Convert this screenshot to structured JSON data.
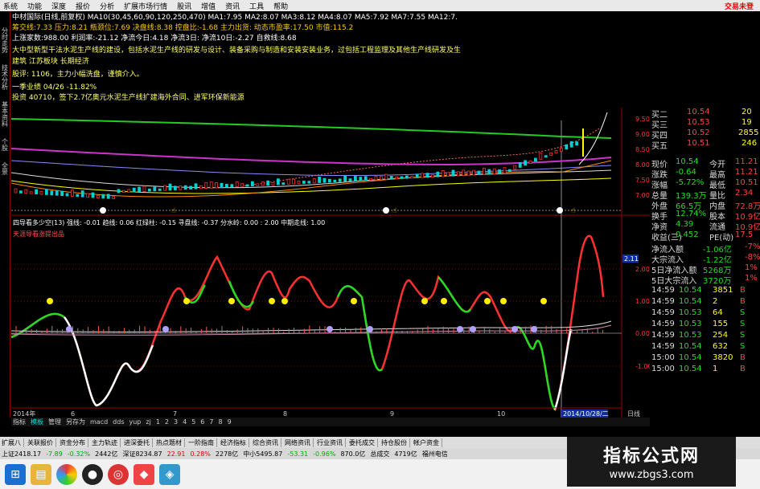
{
  "menu": [
    "系统",
    "功能",
    "深度",
    "报价",
    "分析",
    "扩展市场行情",
    "股讯",
    "增值",
    "资讯",
    "工具",
    "帮助"
  ],
  "brand": "交易未登",
  "lefttabs": [
    "分时走势",
    "技术分析",
    "基本资料",
    "个股",
    "全景"
  ],
  "info": {
    "l1": "中材国际(日线,前复权) MA10(30,45,60,90,120,250,470) MA1:7.95 MA2:8.07 MA3:8.12 MA4:8.07 MA5:7.92 MA7:7.55 MA12:7.",
    "l2": "筹交线:7.33 压力:8.21 瓶颈位:7.69 决盘线:8.38 控盘比:-1.68 主力出货: 动态市盈率:17.50 市值:115.2",
    "l3": "上涨家数:988.00 利润率:-21.12 净流今日:4.18 净流3日: 净流10日:-2.27 自救线:8.68",
    "l4": "大中型新型干法水泥生产线的建设，包括水泥生产线的研发与设计、装备采购与制造和安装安装业务，过包括工程监理及其他生产线研发及生",
    "l5": "建筑 江苏板块 长期经济",
    "l6": "股评: 1106，主力小幅洗盘，谨慎介入。",
    "l7": "一季业绩 04/26 -11.82%",
    "l8": "投资 40710，签下2.7亿奥元水泥生产线扩建海外合同、进军环保新能源"
  },
  "pricelabels": [
    "9.50",
    "9.00",
    "8.50",
    "8.00",
    "7.50",
    "7.00"
  ],
  "sub": {
    "title": "四导看多少空(13) 强线: -0.01 趋线: 0.06 红绿柱: -0.15 寻盘线: -0.37 分水岭: 0.00 : 2.00 中期走线: 1.00",
    "sub2": "天涯导看涨提出品",
    "ylabels": [
      "2.00",
      "1.00",
      "0.00",
      "-1.00"
    ],
    "marker": "2.11"
  },
  "datebar": {
    "year": "2014年",
    "months": [
      "6",
      "7",
      "8",
      "9",
      "10"
    ],
    "date": "2014/10/28/二",
    "right": "日线"
  },
  "right": {
    "bids": [
      {
        "label": "买二",
        "price": "10.54",
        "vol": "20"
      },
      {
        "label": "买三",
        "price": "10.53",
        "vol": "19"
      },
      {
        "label": "买四",
        "price": "10.52",
        "vol": "2855"
      },
      {
        "label": "买五",
        "price": "10.51",
        "vol": "246"
      }
    ],
    "stats": [
      {
        "a": "现价",
        "b": "10.54",
        "c": "今开",
        "d": "11.21"
      },
      {
        "a": "涨跌",
        "b": "-0.64",
        "c": "最高",
        "d": "11.21"
      },
      {
        "a": "涨幅",
        "b": "-5.72%",
        "c": "最低",
        "d": "10.51"
      },
      {
        "a": "总量",
        "b": "139.3万",
        "c": "量比",
        "d": "2.34"
      },
      {
        "a": "外盘",
        "b": "66.5万",
        "c": "内盘",
        "d": "72.8万"
      },
      {
        "a": "换手",
        "b": "12.74%",
        "c": "股本",
        "d": "10.9亿"
      },
      {
        "a": "净资",
        "b": "4.39",
        "c": "流通",
        "d": "10.9亿"
      },
      {
        "a": "收益(三)",
        "b": "0.452",
        "c": "PE(动)",
        "d": "17.5"
      }
    ],
    "flows": [
      {
        "a": "净流入额",
        "b": "-1.06亿",
        "c": "-7%"
      },
      {
        "a": "大宗流入",
        "b": "-1.22亿",
        "c": "-8%"
      },
      {
        "a": "5日净流入额",
        "b": "5268万",
        "c": "1%"
      },
      {
        "a": "5日大宗流入",
        "b": "3720万",
        "c": "1%"
      }
    ],
    "ticks": [
      {
        "t": "14:59",
        "p": "10.54",
        "v": "3851",
        "s": "B"
      },
      {
        "t": "14:59",
        "p": "10.54",
        "v": "2",
        "s": "B"
      },
      {
        "t": "14:59",
        "p": "10.53",
        "v": "64",
        "s": "S"
      },
      {
        "t": "14:59",
        "p": "10.53",
        "v": "155",
        "s": "S"
      },
      {
        "t": "14:59",
        "p": "10.53",
        "v": "254",
        "s": "S"
      },
      {
        "t": "14:59",
        "p": "10.54",
        "v": "632",
        "s": "S"
      },
      {
        "t": "15:00",
        "p": "10.54",
        "v": "3820",
        "s": "B"
      },
      {
        "t": "15:00",
        "p": "10.54",
        "v": "1",
        "s": "B"
      }
    ]
  },
  "tabs": [
    "指标",
    "模板",
    "管理",
    "另存为",
    "macd",
    "dds",
    "yup",
    "zj",
    "1",
    "2",
    "3",
    "4",
    "5",
    "6",
    "7",
    "8",
    "9"
  ],
  "func": [
    "扩展八",
    "关联报价",
    "资金分布",
    "主力轨迹",
    "进深委托",
    "热点题材",
    "一阶指南",
    "经济指标",
    "综合资讯",
    "网络资讯",
    "行业资讯",
    "委托成交",
    "持仓股份",
    "帐户资金"
  ],
  "status": {
    "sh": "上证2418.17",
    "shchg": "-7.89",
    "shpct": "-0.32%",
    "shvol": "2442亿",
    "sz": "深证8234.87",
    "szchg": "22.91",
    "szpct": "0.28%",
    "szvol": "2278亿",
    "zx": "中小5495.87",
    "zxchg": "-53.31",
    "zxpct": "-0.96%",
    "zxvol": "870.0亿",
    "total": "总成交",
    "totalv": "4719亿",
    "feed": "福州电信"
  },
  "logo": {
    "cn": "指标公式网",
    "url": "www.zbgs3.com"
  },
  "colors": {
    "up": "#ff3030",
    "down": "#22dd22",
    "yellow": "#ffff00",
    "cyan": "#00e0e0"
  }
}
